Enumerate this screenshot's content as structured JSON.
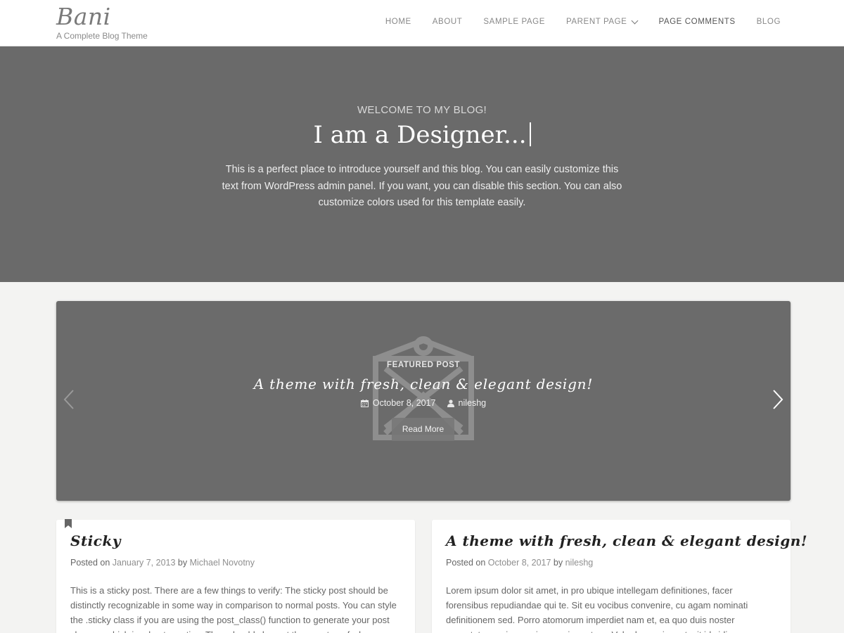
{
  "header": {
    "site_title": "Bani",
    "site_description": "A Complete Blog Theme",
    "nav": [
      {
        "label": "HOME"
      },
      {
        "label": "ABOUT"
      },
      {
        "label": "SAMPLE PAGE"
      },
      {
        "label": "PARENT PAGE"
      },
      {
        "label": "PAGE COMMENTS"
      },
      {
        "label": "BLOG"
      }
    ]
  },
  "hero": {
    "kicker": "WELCOME TO MY BLOG!",
    "title": "I am a Designer...",
    "text": "This is a perfect place to introduce yourself and this blog. You can easily customize this text from WordPress admin panel. If you want, you can disable this section. You can also customize colors used for this template easily."
  },
  "slider": {
    "label": "FEATURED POST",
    "title": "A theme with fresh, clean & elegant design!",
    "date": "October 8, 2017",
    "author": "nileshg",
    "button": "Read More"
  },
  "posts": [
    {
      "title": "Sticky",
      "posted_on": "Posted on",
      "date": "January 7, 2013",
      "by": "by",
      "author": "Michael Novotny",
      "excerpt": "This is a sticky post. There are a few things to verify: The sticky post should be distinctly recognizable in some way in comparison to normal posts. You can style the .sticky class if you are using the post_class() function to generate your post classes, which is a best practice. They should show at the very top of who"
    },
    {
      "title": "A theme with fresh, clean & elegant design!",
      "posted_on": "Posted on",
      "date": "October 8, 2017",
      "by": "by",
      "author": "nileshg",
      "excerpt": "Lorem ipsum dolor sit amet, in pro ubique intellegam definitiones, facer forensibus repudiandae qui te. Sit eu vocibus convenire, cu agam nominati definitionem sed. Porro atomorum imperdiet nam et, ea quo duis noster consetetur, mei an meis graeci oportere. Vel adversarium ut, sit id vidisse admodum"
    }
  ],
  "colors": {
    "hero_bg": "#6a6a6a",
    "page_bg": "#f3f3f2",
    "card_bg": "#ffffff"
  }
}
